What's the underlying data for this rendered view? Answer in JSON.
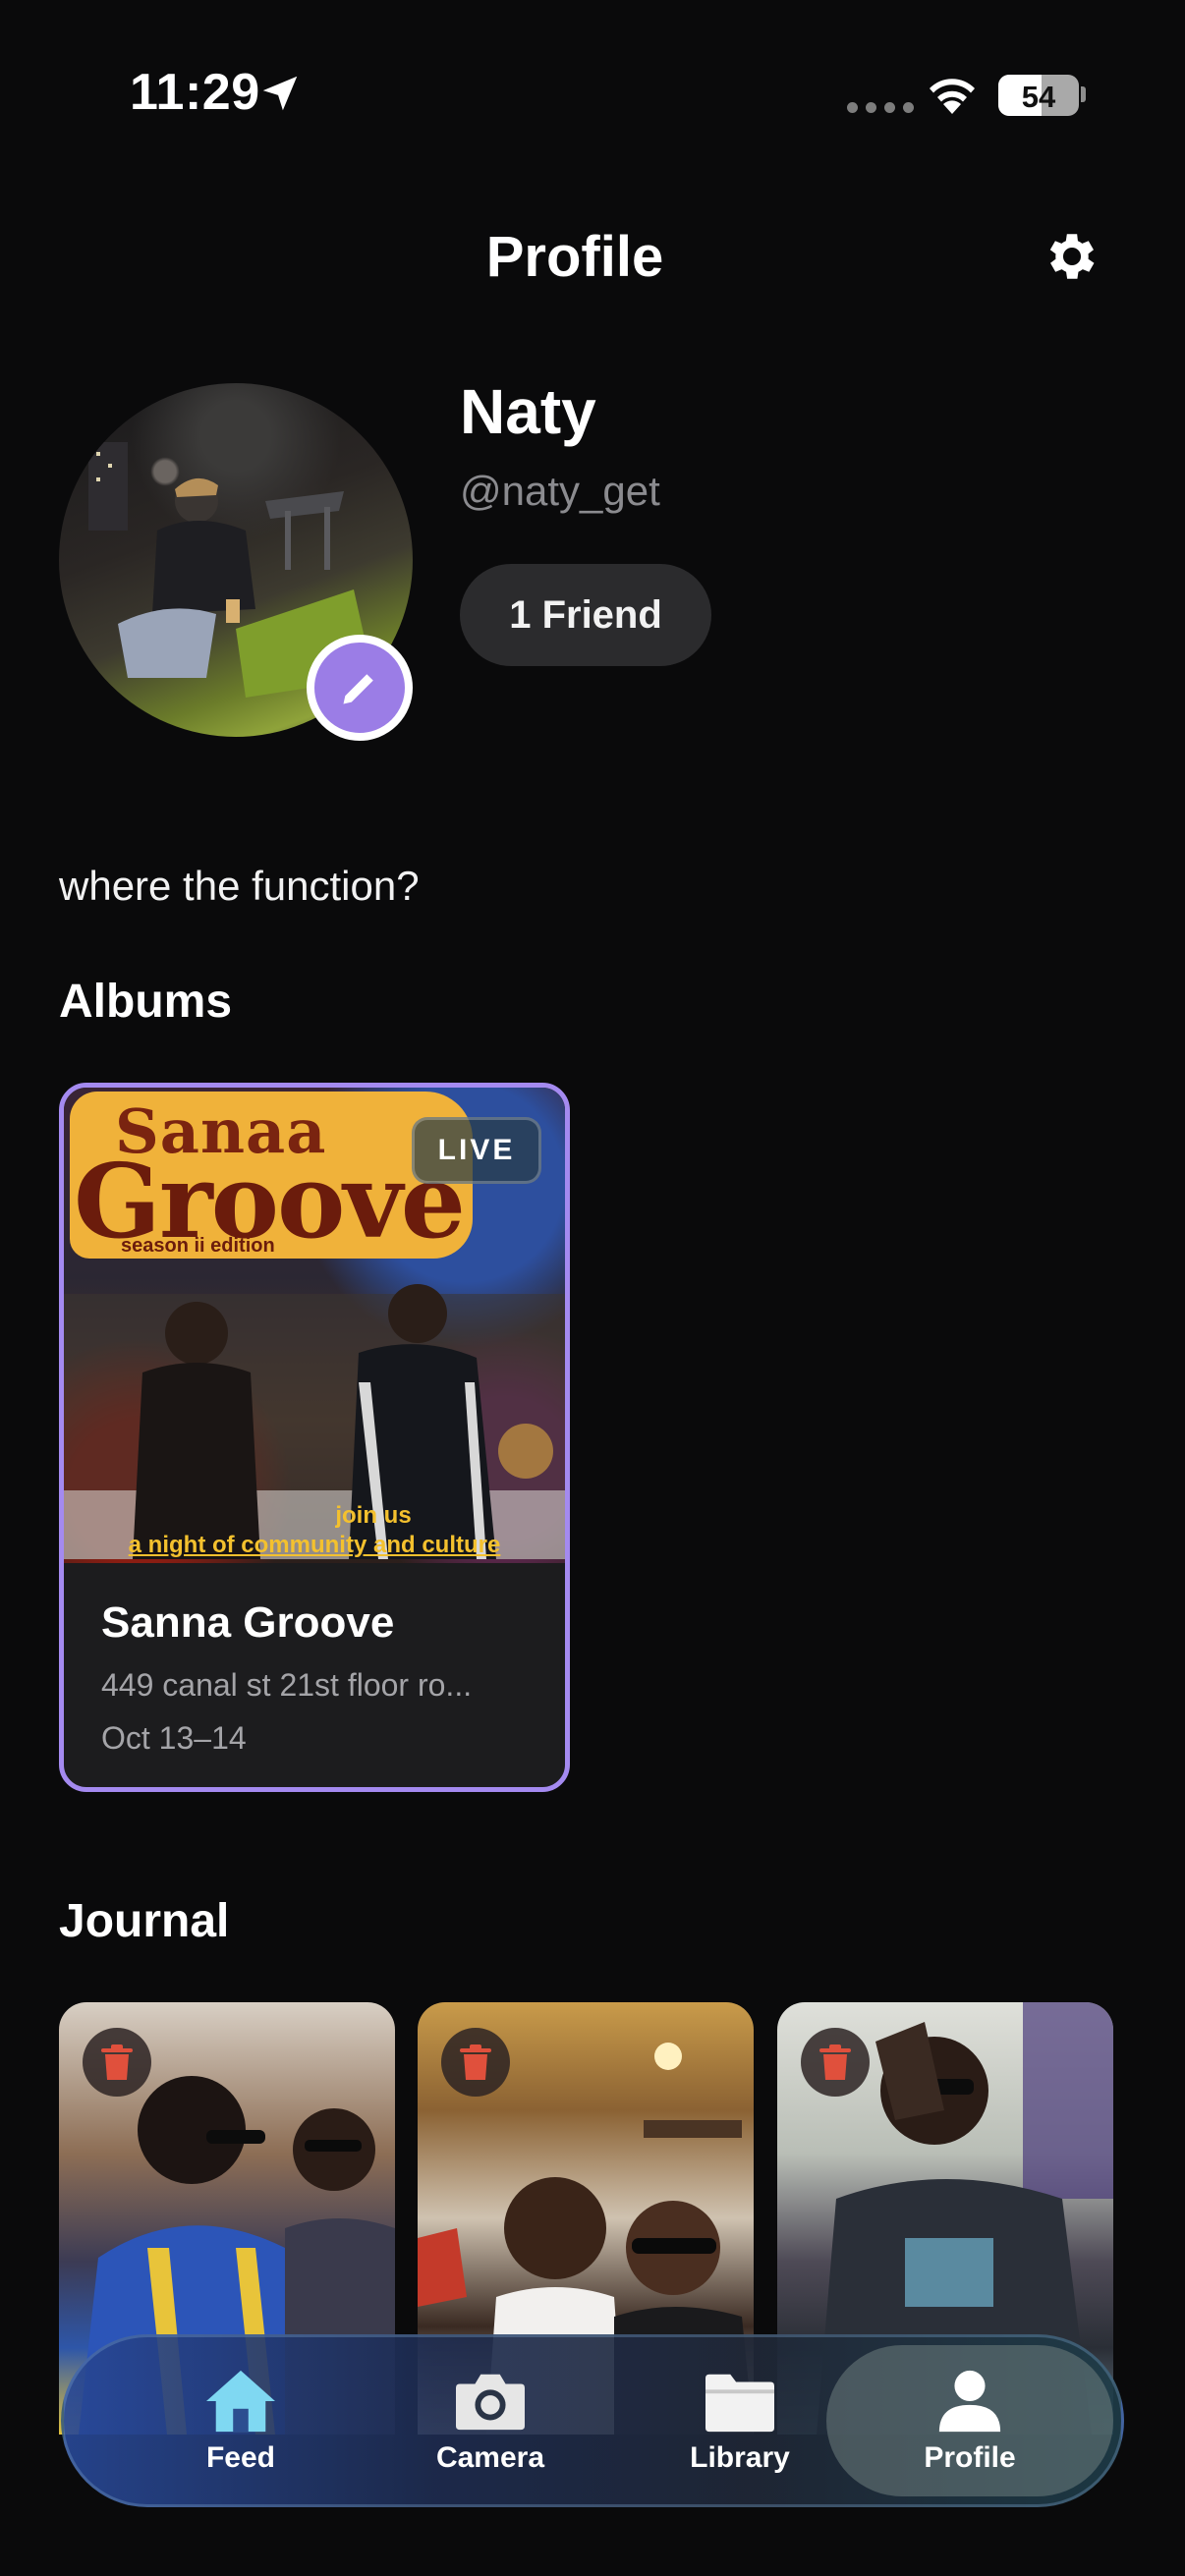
{
  "status_bar": {
    "time": "11:29",
    "battery": "54",
    "battery_level": 0.54
  },
  "header": {
    "title": "Profile",
    "settings_icon": "gear-icon"
  },
  "profile": {
    "display_name": "Naty",
    "username": "@naty_get",
    "friends_label": "1 Friend",
    "bio": "where the function?",
    "accent_color": "#9b7de6"
  },
  "albums": {
    "section_title": "Albums",
    "items": [
      {
        "name": "Sanna Groove",
        "location": "449 canal st 21st floor ro...",
        "dates": "Oct 13–14",
        "badge": "LIVE",
        "cover": {
          "title_top": "Sanaa",
          "title_main": "Groove",
          "edition": "season ii edition",
          "join_text": "join us",
          "tagline": "a night of community and culture"
        }
      }
    ]
  },
  "journal": {
    "section_title": "Journal",
    "items": [
      {
        "delete_icon": "trash-icon"
      },
      {
        "delete_icon": "trash-icon"
      },
      {
        "delete_icon": "trash-icon"
      }
    ]
  },
  "tab_bar": {
    "items": [
      {
        "label": "Feed",
        "icon": "home-icon"
      },
      {
        "label": "Camera",
        "icon": "camera-icon"
      },
      {
        "label": "Library",
        "icon": "folder-icon"
      },
      {
        "label": "Profile",
        "icon": "person-icon",
        "selected": true
      }
    ]
  }
}
